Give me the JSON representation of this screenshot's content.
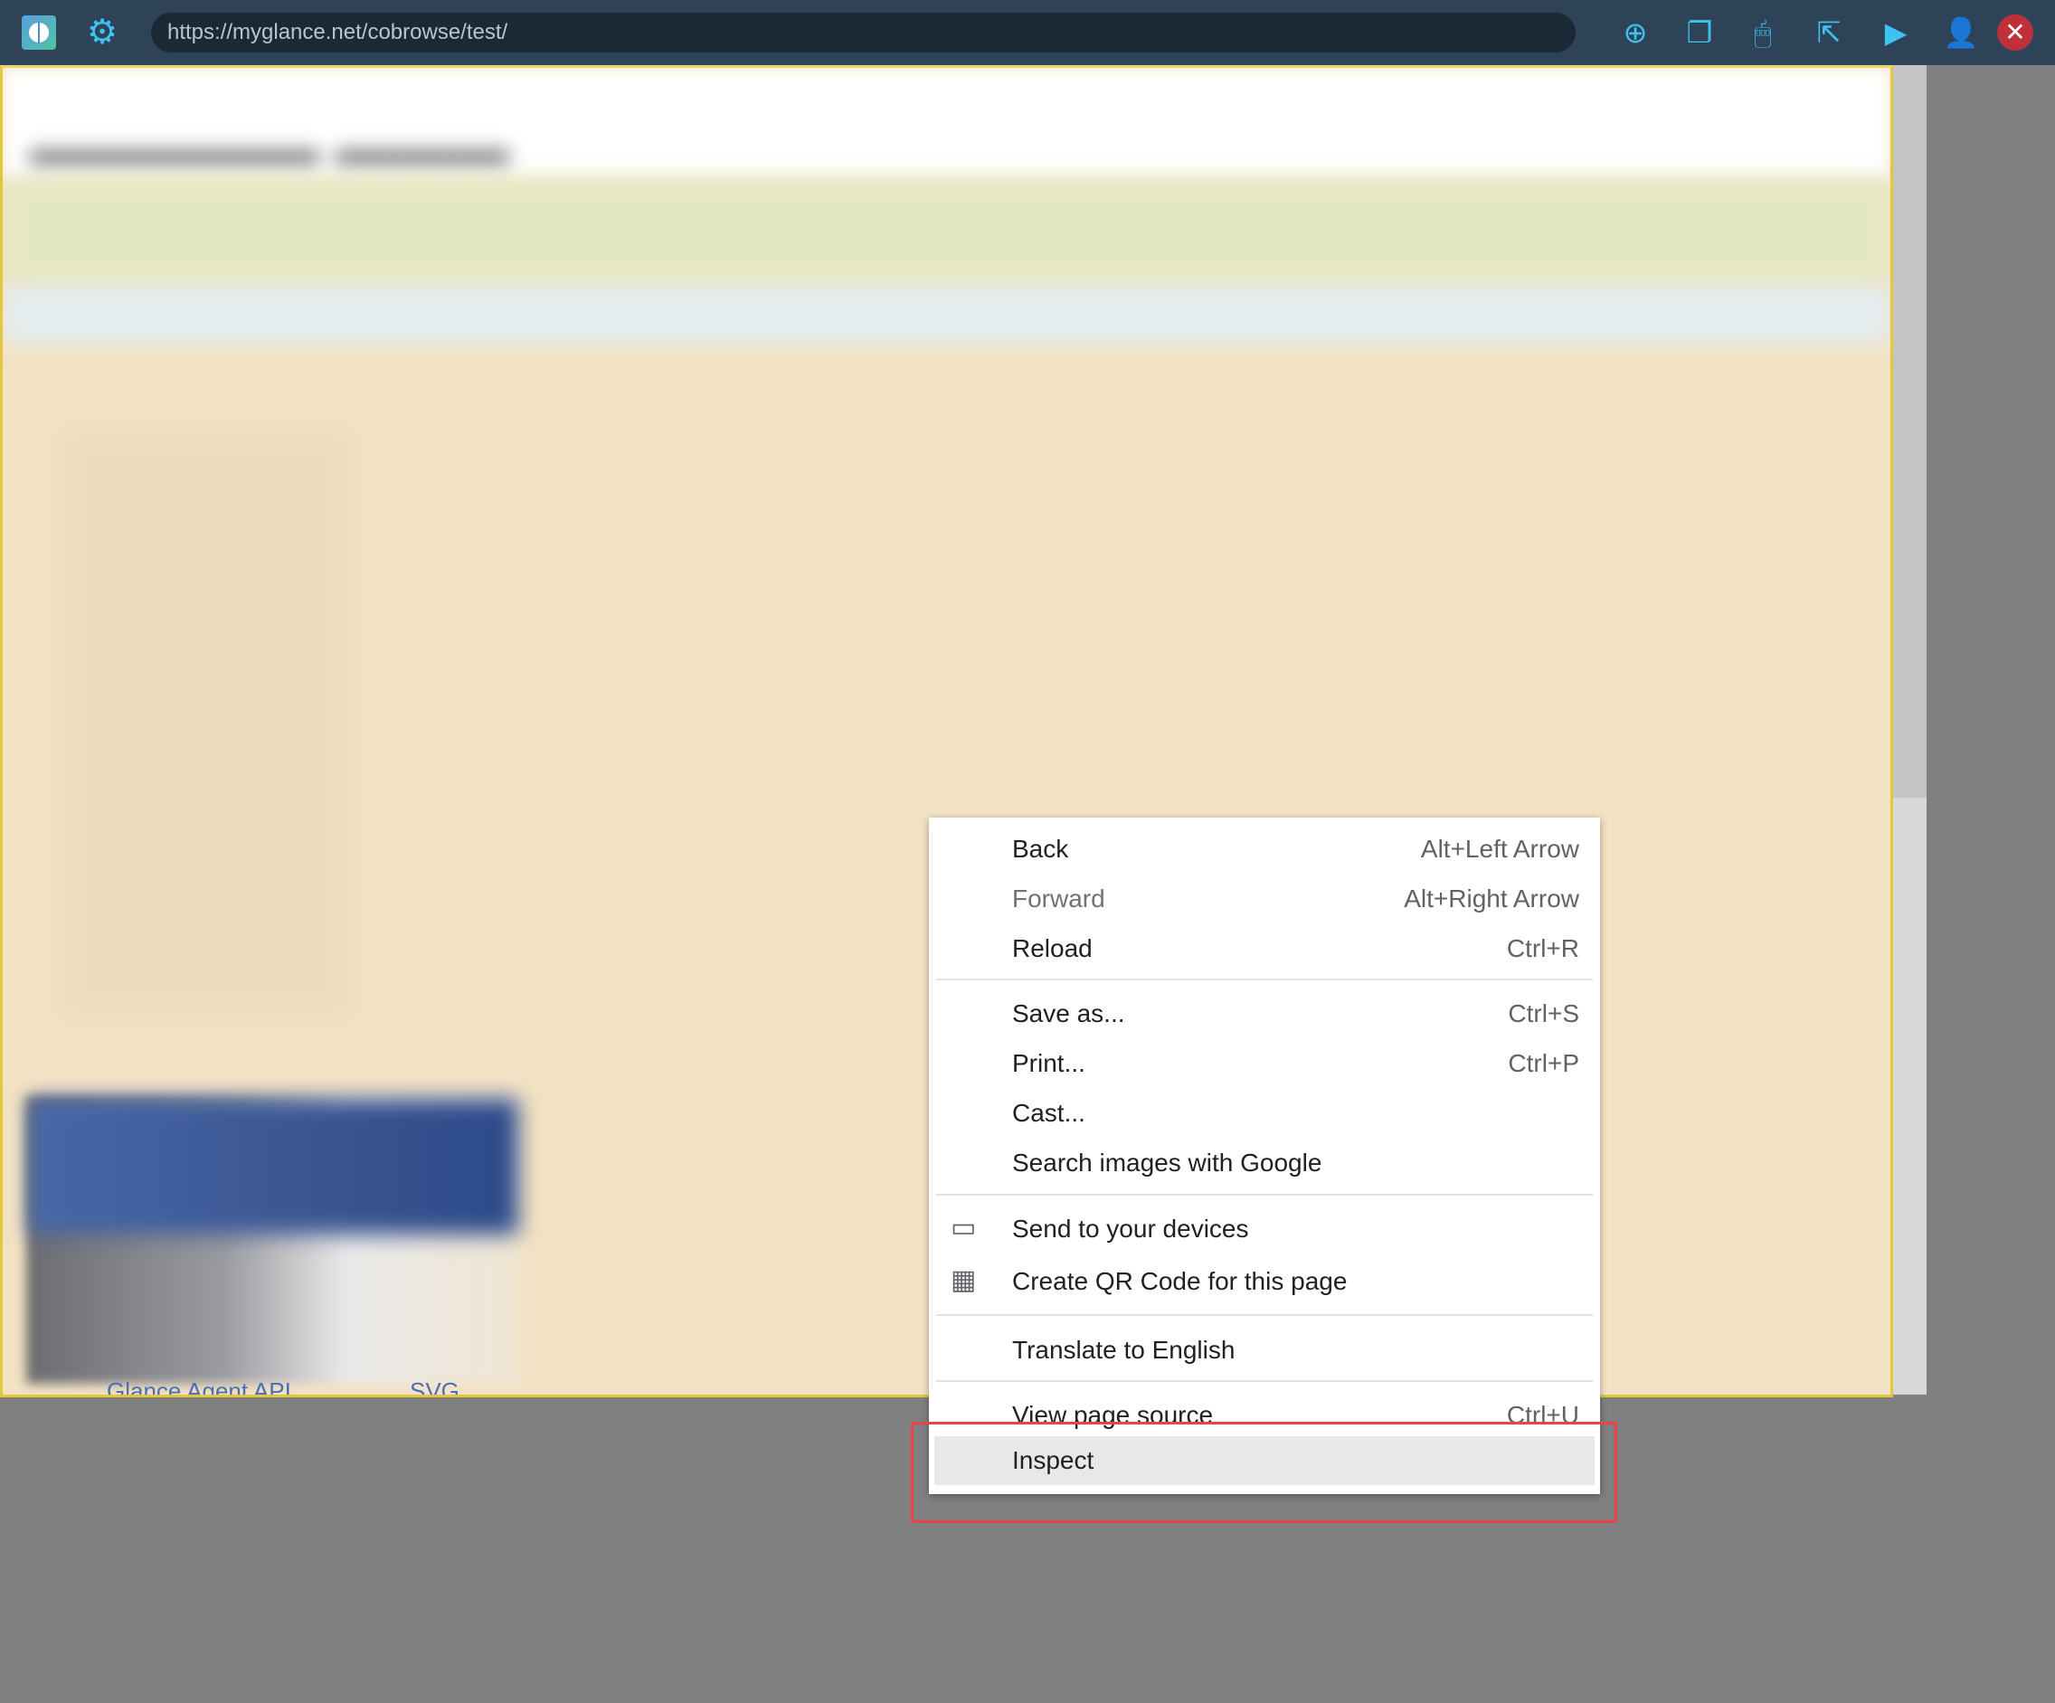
{
  "toolbar": {
    "url": "https://myglance.net/cobrowse/test/",
    "icons": [
      "app-logo-icon",
      "settings-gear-icon",
      "add-participant-icon",
      "screen-share-icon",
      "remote-control-mouse-icon",
      "share-icon",
      "video-icon",
      "participant-info-icon",
      "close-session-icon"
    ],
    "accent": "#3cc3f0",
    "close_color": "#c0303a"
  },
  "page": {
    "background": "#f3e3c5",
    "border_color": "#e3c83a",
    "partial_links": [
      "Glance Agent API",
      "SVG"
    ]
  },
  "context_menu": {
    "items": [
      {
        "label": "Back",
        "shortcut": "Alt+Left Arrow"
      },
      {
        "label": "Forward",
        "shortcut": "Alt+Right Arrow",
        "disabled": true
      },
      {
        "label": "Reload",
        "shortcut": "Ctrl+R"
      },
      {
        "label": "Save as...",
        "shortcut": "Ctrl+S"
      },
      {
        "label": "Print...",
        "shortcut": "Ctrl+P"
      },
      {
        "label": "Cast..."
      },
      {
        "label": "Search images with Google"
      },
      {
        "label": "Send to your devices",
        "icon": "devices-icon"
      },
      {
        "label": "Create QR Code for this page",
        "icon": "qr-code-icon"
      },
      {
        "label": "Translate to English"
      },
      {
        "label": "View page source",
        "shortcut": "Ctrl+U"
      },
      {
        "label": "Inspect",
        "highlighted": true
      }
    ],
    "highlight_box_color": "#e8444a"
  }
}
